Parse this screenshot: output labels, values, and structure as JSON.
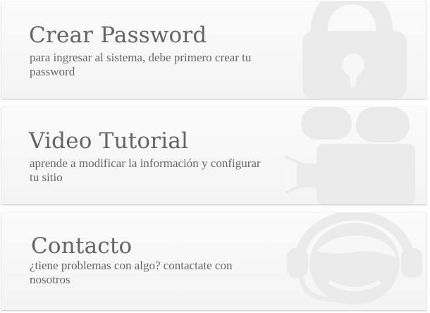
{
  "cards": [
    {
      "title": "Crear Password",
      "subtitle": "para ingresar al sistema, debe primero crear tu password",
      "icon": "lock-icon"
    },
    {
      "title": "Video Tutorial",
      "subtitle": "aprende a modificar la información y configurar tu sitio",
      "icon": "video-camera-icon"
    },
    {
      "title": "Contacto",
      "subtitle": "¿tiene problemas con algo? contactate con nosotros",
      "icon": "headset-icon"
    }
  ],
  "colors": {
    "card_bg": "#f7f7f7",
    "text": "#646464",
    "icon": "#ebebeb"
  }
}
